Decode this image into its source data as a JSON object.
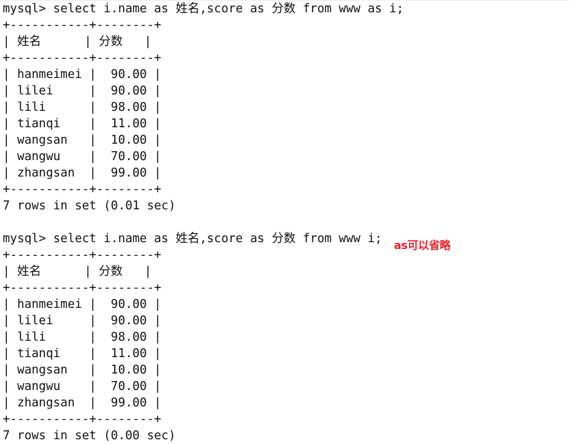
{
  "terminal": {
    "background_color": "#ffffff",
    "text_color": "#121212",
    "lines": [
      "mysql> select i.name as 姓名,score as 分数 from www as i;",
      "+-----------+--------+",
      "| 姓名      | 分数   |",
      "+-----------+--------+",
      "| hanmeimei |  90.00 |",
      "| lilei     |  90.00 |",
      "| lili      |  98.00 |",
      "| tianqi    |  11.00 |",
      "| wangsan   |  10.00 |",
      "| wangwu    |  70.00 |",
      "| zhangsan  |  99.00 |",
      "+-----------+--------+",
      "7 rows in set (0.01 sec)",
      "",
      "mysql> select i.name as 姓名,score as 分数 from www i;",
      "+-----------+--------+",
      "| 姓名      | 分数   |",
      "+-----------+--------+",
      "| hanmeimei |  90.00 |",
      "| lilei     |  90.00 |",
      "| lili      |  98.00 |",
      "| tianqi    |  11.00 |",
      "| wangsan   |  10.00 |",
      "| wangwu    |  70.00 |",
      "| zhangsan  |  99.00 |",
      "+-----------+--------+",
      "7 rows in set (0.00 sec)"
    ]
  },
  "queries": [
    {
      "prompt": "mysql>",
      "sql": "select i.name as 姓名,score as 分数 from www as i;",
      "result_columns": [
        "姓名",
        "分数"
      ],
      "result_rows": [
        [
          "hanmeimei",
          "90.00"
        ],
        [
          "lilei",
          "90.00"
        ],
        [
          "lili",
          "98.00"
        ],
        [
          "tianqi",
          "11.00"
        ],
        [
          "wangsan",
          "10.00"
        ],
        [
          "wangwu",
          "70.00"
        ],
        [
          "zhangsan",
          "99.00"
        ]
      ],
      "status": "7 rows in set (0.01 sec)",
      "row_count": 7,
      "duration_sec": "0.01"
    },
    {
      "prompt": "mysql>",
      "sql": "select i.name as 姓名,score as 分数 from www i;",
      "result_columns": [
        "姓名",
        "分数"
      ],
      "result_rows": [
        [
          "hanmeimei",
          "90.00"
        ],
        [
          "lilei",
          "90.00"
        ],
        [
          "lili",
          "98.00"
        ],
        [
          "tianqi",
          "11.00"
        ],
        [
          "wangsan",
          "10.00"
        ],
        [
          "wangwu",
          "70.00"
        ],
        [
          "zhangsan",
          "99.00"
        ]
      ],
      "status": "7 rows in set (0.00 sec)",
      "row_count": 7,
      "duration_sec": "0.00"
    }
  ],
  "annotation": {
    "text": "as可以省略",
    "color": "#e8202a"
  }
}
